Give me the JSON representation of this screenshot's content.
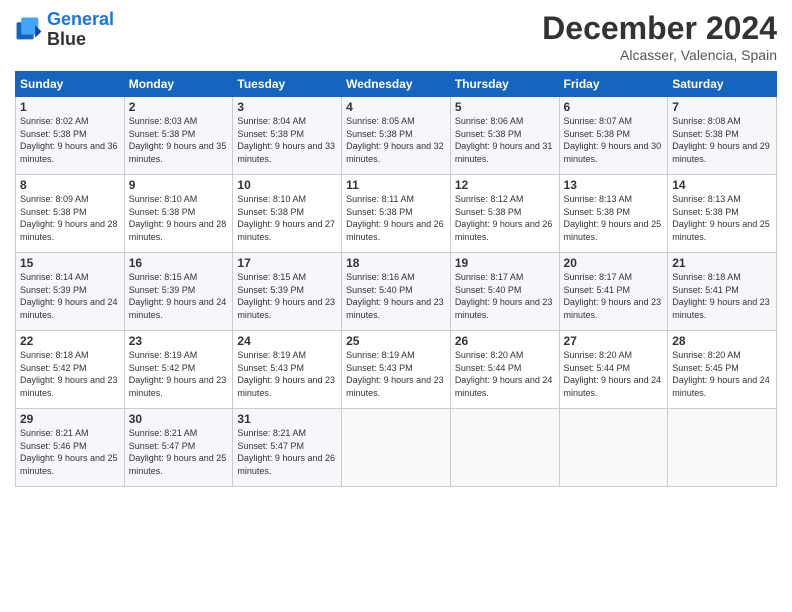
{
  "logo": {
    "line1": "General",
    "line2": "Blue"
  },
  "title": "December 2024",
  "location": "Alcasser, Valencia, Spain",
  "days_of_week": [
    "Sunday",
    "Monday",
    "Tuesday",
    "Wednesday",
    "Thursday",
    "Friday",
    "Saturday"
  ],
  "weeks": [
    [
      {
        "day": "1",
        "sunrise": "8:02 AM",
        "sunset": "5:38 PM",
        "daylight": "9 hours and 36 minutes."
      },
      {
        "day": "2",
        "sunrise": "8:03 AM",
        "sunset": "5:38 PM",
        "daylight": "9 hours and 35 minutes."
      },
      {
        "day": "3",
        "sunrise": "8:04 AM",
        "sunset": "5:38 PM",
        "daylight": "9 hours and 33 minutes."
      },
      {
        "day": "4",
        "sunrise": "8:05 AM",
        "sunset": "5:38 PM",
        "daylight": "9 hours and 32 minutes."
      },
      {
        "day": "5",
        "sunrise": "8:06 AM",
        "sunset": "5:38 PM",
        "daylight": "9 hours and 31 minutes."
      },
      {
        "day": "6",
        "sunrise": "8:07 AM",
        "sunset": "5:38 PM",
        "daylight": "9 hours and 30 minutes."
      },
      {
        "day": "7",
        "sunrise": "8:08 AM",
        "sunset": "5:38 PM",
        "daylight": "9 hours and 29 minutes."
      }
    ],
    [
      {
        "day": "8",
        "sunrise": "8:09 AM",
        "sunset": "5:38 PM",
        "daylight": "9 hours and 28 minutes."
      },
      {
        "day": "9",
        "sunrise": "8:10 AM",
        "sunset": "5:38 PM",
        "daylight": "9 hours and 28 minutes."
      },
      {
        "day": "10",
        "sunrise": "8:10 AM",
        "sunset": "5:38 PM",
        "daylight": "9 hours and 27 minutes."
      },
      {
        "day": "11",
        "sunrise": "8:11 AM",
        "sunset": "5:38 PM",
        "daylight": "9 hours and 26 minutes."
      },
      {
        "day": "12",
        "sunrise": "8:12 AM",
        "sunset": "5:38 PM",
        "daylight": "9 hours and 26 minutes."
      },
      {
        "day": "13",
        "sunrise": "8:13 AM",
        "sunset": "5:38 PM",
        "daylight": "9 hours and 25 minutes."
      },
      {
        "day": "14",
        "sunrise": "8:13 AM",
        "sunset": "5:38 PM",
        "daylight": "9 hours and 25 minutes."
      }
    ],
    [
      {
        "day": "15",
        "sunrise": "8:14 AM",
        "sunset": "5:39 PM",
        "daylight": "9 hours and 24 minutes."
      },
      {
        "day": "16",
        "sunrise": "8:15 AM",
        "sunset": "5:39 PM",
        "daylight": "9 hours and 24 minutes."
      },
      {
        "day": "17",
        "sunrise": "8:15 AM",
        "sunset": "5:39 PM",
        "daylight": "9 hours and 23 minutes."
      },
      {
        "day": "18",
        "sunrise": "8:16 AM",
        "sunset": "5:40 PM",
        "daylight": "9 hours and 23 minutes."
      },
      {
        "day": "19",
        "sunrise": "8:17 AM",
        "sunset": "5:40 PM",
        "daylight": "9 hours and 23 minutes."
      },
      {
        "day": "20",
        "sunrise": "8:17 AM",
        "sunset": "5:41 PM",
        "daylight": "9 hours and 23 minutes."
      },
      {
        "day": "21",
        "sunrise": "8:18 AM",
        "sunset": "5:41 PM",
        "daylight": "9 hours and 23 minutes."
      }
    ],
    [
      {
        "day": "22",
        "sunrise": "8:18 AM",
        "sunset": "5:42 PM",
        "daylight": "9 hours and 23 minutes."
      },
      {
        "day": "23",
        "sunrise": "8:19 AM",
        "sunset": "5:42 PM",
        "daylight": "9 hours and 23 minutes."
      },
      {
        "day": "24",
        "sunrise": "8:19 AM",
        "sunset": "5:43 PM",
        "daylight": "9 hours and 23 minutes."
      },
      {
        "day": "25",
        "sunrise": "8:19 AM",
        "sunset": "5:43 PM",
        "daylight": "9 hours and 23 minutes."
      },
      {
        "day": "26",
        "sunrise": "8:20 AM",
        "sunset": "5:44 PM",
        "daylight": "9 hours and 24 minutes."
      },
      {
        "day": "27",
        "sunrise": "8:20 AM",
        "sunset": "5:44 PM",
        "daylight": "9 hours and 24 minutes."
      },
      {
        "day": "28",
        "sunrise": "8:20 AM",
        "sunset": "5:45 PM",
        "daylight": "9 hours and 24 minutes."
      }
    ],
    [
      {
        "day": "29",
        "sunrise": "8:21 AM",
        "sunset": "5:46 PM",
        "daylight": "9 hours and 25 minutes."
      },
      {
        "day": "30",
        "sunrise": "8:21 AM",
        "sunset": "5:47 PM",
        "daylight": "9 hours and 25 minutes."
      },
      {
        "day": "31",
        "sunrise": "8:21 AM",
        "sunset": "5:47 PM",
        "daylight": "9 hours and 26 minutes."
      },
      null,
      null,
      null,
      null
    ]
  ]
}
